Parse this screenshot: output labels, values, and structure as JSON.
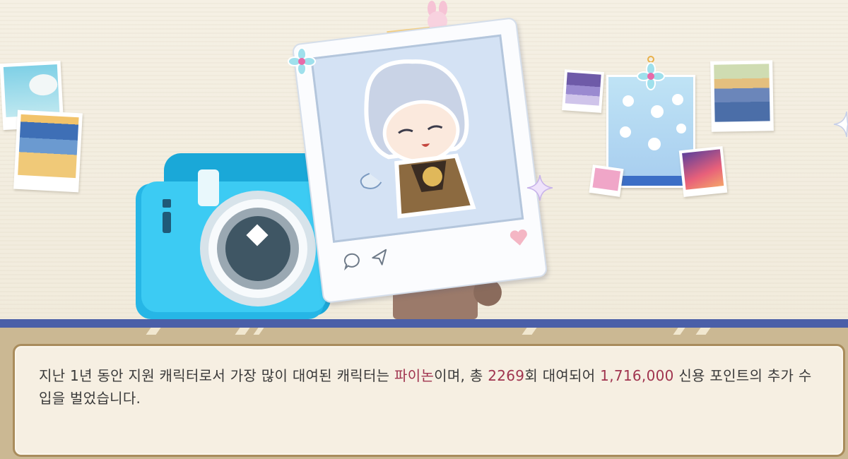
{
  "dialog": {
    "segments": [
      {
        "text": "지난 1년 동안 지원 캐릭터로서 가장 많이 대여된 캐릭터는 ",
        "highlight": false
      },
      {
        "text": "파이논",
        "highlight": true
      },
      {
        "text": "이며, 총 ",
        "highlight": false
      },
      {
        "text": "2269",
        "highlight": true
      },
      {
        "text": "회 대여되어 ",
        "highlight": false
      },
      {
        "text": "1,716,000",
        "highlight": true
      },
      {
        "text": " 신용 포인트의 추가 수입을 벌었습니다.",
        "highlight": false
      }
    ]
  },
  "colors": {
    "highlight": "#a0344f",
    "camera": "#2ec4f0",
    "shelf": "#4a5fa8",
    "dialog_border": "#a98c5c"
  },
  "icons": [
    "camera-icon",
    "chat-bubble-icon",
    "send-icon",
    "heart-icon",
    "flower-pin-icon",
    "sparkle-icon",
    "bunny-clip-icon"
  ]
}
